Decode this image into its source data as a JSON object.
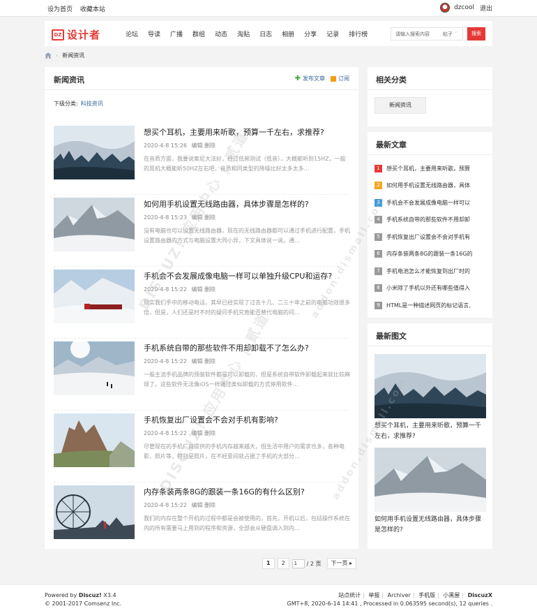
{
  "topbar": {
    "set_home": "设为首页",
    "favorite": "收藏本站",
    "username": "dzcool",
    "logout": "退出"
  },
  "header": {
    "logo_badge": "DZ",
    "logo_text": "设计者",
    "nav": [
      "论坛",
      "导读",
      "广播",
      "群组",
      "动态",
      "淘贴",
      "日志",
      "相册",
      "分享",
      "记录",
      "排行榜"
    ],
    "search_placeholder": "请输入搜索内容",
    "search_type": "帖子",
    "search_button": "搜索"
  },
  "breadcrumb": {
    "current": "新闻资讯"
  },
  "main": {
    "title": "新闻资讯",
    "post_article": "发布文章",
    "subscribe": "订阅",
    "sub_label": "下级分类:",
    "sub_link": "科技资讯",
    "articles": [
      {
        "title": "想买个耳机，主要用来听歌，预算一千左右，求推荐?",
        "date": "2020-4-8 15:26",
        "edit": "编辑",
        "delete": "删除",
        "desc": "在音质方面，我要说索尼大法好，经过低频测试（低音），大概能听到15HZ，一般的耳机大概能听50HZ左右吧，音质和同类型的降噪比好太多太多…"
      },
      {
        "title": "如何用手机设置无线路由器，具体步骤是怎样的?",
        "date": "2020-4-8 15:23",
        "edit": "编辑",
        "delete": "删除",
        "desc": "没有电脑也可以设置无线路由器，现在的无线路由器都可以通过手机进行配置，手机设置路由器的方式与电脑设置大同小异，下文具体说一说。通…"
      },
      {
        "title": "手机会不会发展成像电脑一样可以单独升级CPU和运存?",
        "date": "2020-4-8 15:22",
        "edit": "编辑",
        "delete": "删除",
        "desc": "现实我们手中的移动电话，其早已经实现了过去十几、二三十年之前的电脑功效很多倍，但是，人们还是时不时的疑问手机究竟能否替代电脑的问…"
      },
      {
        "title": "手机系统自带的那些软件不用却卸载不了怎么办?",
        "date": "2020-4-8 15:22",
        "edit": "编辑",
        "delete": "删除",
        "desc": "一般主流手机品牌的预装软件都是可以卸载的，但是系统自带软件卸载起来就比较麻烦了。这些软件无法像iOS一样通过类似卸载的方式停用软件…"
      },
      {
        "title": "手机恢复出厂设置会不会对手机有影响?",
        "date": "2020-4-8 15:22",
        "edit": "编辑",
        "delete": "删除",
        "desc": "尽管现在的手机厂商提供的手机内存越来越大，但生活中用户的需求也多，各种电影、照片等，特别是照片，在不经意间就占据了手机的大部分…"
      },
      {
        "title": "内存条装两条8G的跟装一条16G的有什么区别?",
        "date": "2020-4-8 15:22",
        "edit": "编辑",
        "delete": "删除",
        "desc": "我们的内存在整个开机的过程中都是会被使用的，首先，开机以后，包括操作系统在内的所有需要马上用到的程序和资源，全部会从硬盘调入到内…"
      }
    ]
  },
  "pager": {
    "page1": "1",
    "page2": "2",
    "input_value": "1",
    "total": "/ 2 页",
    "next": "下一页"
  },
  "sidebar": {
    "related_title": "相关分类",
    "category": "新闻资讯",
    "latest_title": "最新文章",
    "latest": [
      {
        "n": "1",
        "title": "想买个耳机，主要用来听歌，预算",
        "color": "#e53935"
      },
      {
        "n": "2",
        "title": "如何用手机设置无线路由器，具体",
        "color": "#f5a623"
      },
      {
        "n": "3",
        "title": "手机会不会发展成像电脑一样可以",
        "color": "#3b9be0"
      },
      {
        "n": "4",
        "title": "手机系统自带的那些软件不用却卸",
        "color": "#999999"
      },
      {
        "n": "5",
        "title": "手机恢复出厂设置会不会对手机有",
        "color": "#999999"
      },
      {
        "n": "6",
        "title": "内存条装两条8G的跟装一条16G的",
        "color": "#999999"
      },
      {
        "n": "7",
        "title": "手机电池怎么才能恢复到出厂时的",
        "color": "#999999"
      },
      {
        "n": "8",
        "title": "小米除了手机以外还有哪些值得入",
        "color": "#999999"
      },
      {
        "n": "9",
        "title": "HTML是一种描述网页的标记语言,",
        "color": "#999999"
      }
    ],
    "pics_title": "最新图文",
    "pics": [
      {
        "title": "想买个耳机，主要用来听歌，预算一千左右，求推荐?"
      },
      {
        "title": "如何用手机设置无线路由器，具体步骤是怎样的?"
      }
    ]
  },
  "footer": {
    "powered": "Powered by",
    "brand": "Discuz!",
    "version": "X3.4",
    "copyright": "© 2001-2017 Comsenz Inc.",
    "links": [
      "站点统计",
      "举报",
      "Archiver",
      "手机版",
      "小黑屋",
      "DiscuzX"
    ],
    "stats": "GMT+8, 2020-6-14 14:41 , Processed in 0.063595 second(s), 12 queries ."
  },
  "watermarks": [
    "DISCUZ! 应用中心 | 贰道",
    "addon.dismall.com"
  ]
}
